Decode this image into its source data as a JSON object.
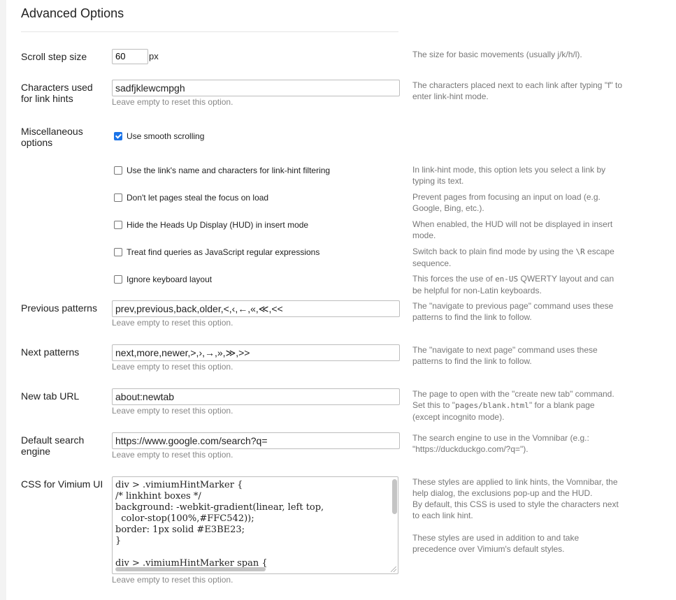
{
  "title": "Advanced Options",
  "scroll_step": {
    "label": "Scroll step size",
    "value": "60",
    "unit": "px",
    "help": "The size for basic movements (usually j/k/h/l)."
  },
  "link_hints": {
    "label": "Characters used for link hints",
    "value": "sadfjklewcmpgh",
    "note": "Leave empty to reset this option.",
    "help": "The characters placed next to each link after typing \"f\" to enter link-hint mode."
  },
  "misc": {
    "label": "Miscellaneous options",
    "options": [
      {
        "label": "Use smooth scrolling",
        "checked": true,
        "help": ""
      },
      {
        "label": "Use the link's name and characters for link-hint filtering",
        "checked": false,
        "help": "In link-hint mode, this option lets you select a link by typing its text."
      },
      {
        "label": "Don't let pages steal the focus on load",
        "checked": false,
        "help": "Prevent pages from focusing an input on load (e.g. Google, Bing, etc.)."
      },
      {
        "label": "Hide the Heads Up Display (HUD) in insert mode",
        "checked": false,
        "help": "When enabled, the HUD will not be displayed in insert mode."
      },
      {
        "label": "Treat find queries as JavaScript regular expressions",
        "checked": false,
        "help_pre": "Switch back to plain find mode by using the ",
        "help_code": "\\R",
        "help_post": " escape sequence."
      },
      {
        "label": "Ignore keyboard layout",
        "checked": false,
        "help_pre": "This forces the use of ",
        "help_code": "en-US",
        "help_post": " QWERTY layout and can be helpful for non-Latin keyboards."
      }
    ]
  },
  "previous_patterns": {
    "label": "Previous patterns",
    "value": "prev,previous,back,older,<,‹,←,«,≪,<<",
    "note": "Leave empty to reset this option.",
    "help": "The \"navigate to previous page\" command uses these patterns to find the link to follow."
  },
  "next_patterns": {
    "label": "Next patterns",
    "value": "next,more,newer,>,›,→,»,≫,>>",
    "note": "Leave empty to reset this option.",
    "help": "The \"navigate to next page\" command uses these patterns to find the link to follow."
  },
  "new_tab_url": {
    "label": "New tab URL",
    "value": "about:newtab",
    "note": "Leave empty to reset this option.",
    "help_pre": "The page to open with the \"create new tab\" command. Set this to \"",
    "help_code": "pages/blank.html",
    "help_post": "\" for a blank page (except incognito mode)."
  },
  "search_engine": {
    "label": "Default search engine",
    "value": "https://www.google.com/search?q=",
    "note": "Leave empty to reset this option.",
    "help": "The search engine to use in the Vomnibar (e.g.: \"https://duckduckgo.com/?q=\")."
  },
  "css": {
    "label": "CSS for Vimium UI",
    "value": "div > .vimiumHintMarker {\n/* linkhint boxes */\nbackground: -webkit-gradient(linear, left top,\n  color-stop(100%,#FFC542));\nborder: 1px solid #E3BE23;\n}\n\ndiv > .vimiumHintMarker span {",
    "note": "Leave empty to reset this option.",
    "help1": "These styles are applied to link hints, the Vomnibar, the help dialog, the exclusions pop-up and the HUD.",
    "help2": "By default, this CSS is used to style the characters next to each link hint.",
    "help3": "These styles are used in addition to and take precedence over Vimium's default styles."
  },
  "colors": {
    "checkbox_checked": "#1a73e8",
    "help_text": "#777777",
    "border": "#bdbdbd"
  }
}
